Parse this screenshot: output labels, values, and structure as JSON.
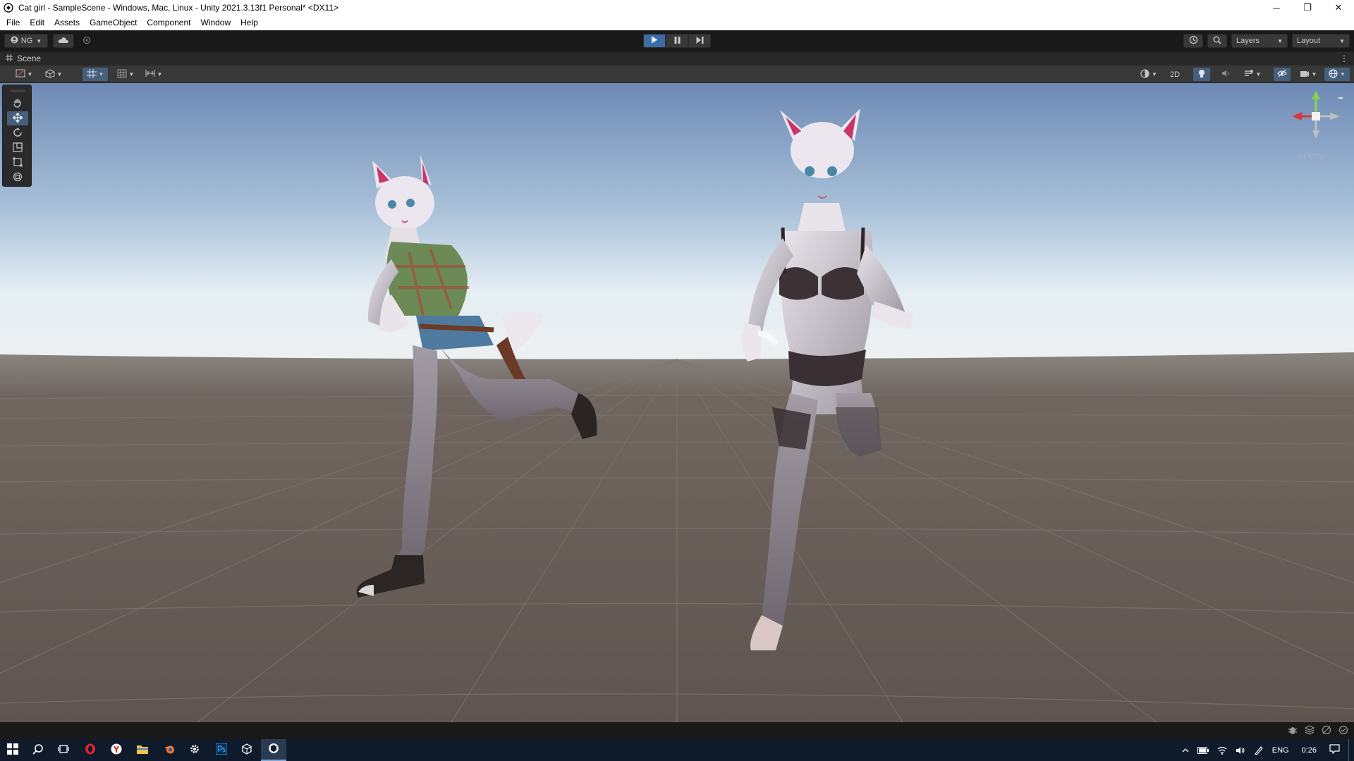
{
  "window": {
    "title": "Cat girl - SampleScene - Windows, Mac, Linux - Unity 2021.3.13f1 Personal* <DX11>",
    "minimize": "─",
    "restore": "❐",
    "close": "✕"
  },
  "menubar": {
    "items": [
      "File",
      "Edit",
      "Assets",
      "GameObject",
      "Component",
      "Window",
      "Help"
    ]
  },
  "toolbar": {
    "account_label": "NG",
    "layers_label": "Layers",
    "layout_label": "Layout"
  },
  "scene": {
    "tab_label": "Scene",
    "toggle_2d_label": "2D",
    "persp_label": "< Persp"
  },
  "taskbar": {
    "language": "ENG",
    "time": "0:26"
  },
  "colors": {
    "play_active": "#3a6ea5",
    "tool_active": "#46607c",
    "gizmo_x": "#d63a3a",
    "gizmo_y": "#8bd14a",
    "gizmo_z": "#4a7fd1",
    "taskbar_bg": "#0f1b2b"
  },
  "icons": [
    "unity-icon",
    "account-icon",
    "cloud-icon",
    "collab-icon",
    "play-icon",
    "pause-icon",
    "step-icon",
    "history-icon",
    "search-icon",
    "hand-tool-icon",
    "move-tool-icon",
    "rotate-tool-icon",
    "scale-tool-icon",
    "rect-tool-icon",
    "transform-tool-icon",
    "windows-start-icon",
    "taskbar-search-icon",
    "task-view-icon",
    "opera-icon",
    "yandex-icon",
    "file-explorer-icon",
    "blender-icon",
    "settings-icon",
    "photoshop-icon",
    "unity-hub-icon",
    "unity-editor-icon"
  ]
}
